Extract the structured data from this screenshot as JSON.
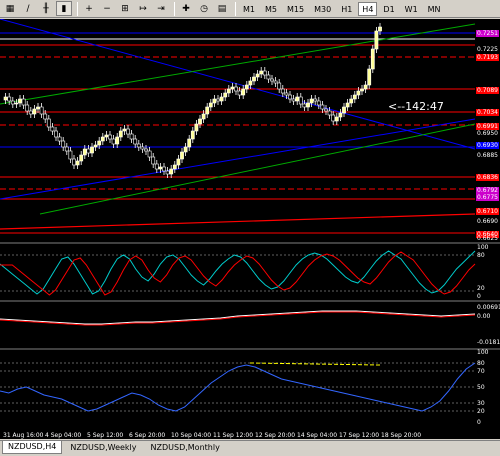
{
  "toolbar": {
    "icons": [
      {
        "name": "new-chart-icon",
        "glyph": "▦"
      },
      {
        "name": "line-chart-icon",
        "glyph": "∕"
      },
      {
        "name": "bar-chart-icon",
        "glyph": "╫"
      },
      {
        "name": "candlestick-icon",
        "glyph": "▮"
      },
      {
        "name": "zoom-in-icon",
        "glyph": "+"
      },
      {
        "name": "zoom-out-icon",
        "glyph": "−"
      },
      {
        "name": "tile-windows-icon",
        "glyph": "⊞"
      },
      {
        "name": "autoscroll-icon",
        "glyph": "↦"
      },
      {
        "name": "chart-shift-icon",
        "glyph": "⇥"
      },
      {
        "name": "indicators-icon",
        "glyph": "✚"
      },
      {
        "name": "periods-icon",
        "glyph": "◷"
      },
      {
        "name": "templates-icon",
        "glyph": "▤"
      }
    ],
    "timeframes": [
      "M1",
      "M5",
      "M15",
      "M30",
      "H1",
      "H4",
      "D1",
      "W1",
      "MN"
    ],
    "active_timeframe": "H4"
  },
  "chart": {
    "timer_label": "<--142:47",
    "price_labels": [
      {
        "text": "0.7251",
        "color": "#cc00cc"
      },
      {
        "text": "0.7225",
        "color": "#000000"
      },
      {
        "text": "0.7193",
        "color": "#ff0000"
      },
      {
        "text": "0.7089",
        "color": "#ff0000"
      },
      {
        "text": "0.7034",
        "color": "#ff0000"
      },
      {
        "text": "0.6991",
        "color": "#ff0000"
      },
      {
        "text": "0.6950",
        "color": "#000000"
      },
      {
        "text": "0.6930",
        "color": "#0000ff"
      },
      {
        "text": "0.6885",
        "color": "#000000"
      },
      {
        "text": "0.6836",
        "color": "#ff0000"
      },
      {
        "text": "0.6792",
        "color": "#cc00cc"
      },
      {
        "text": "0.6775",
        "color": "#cc00cc"
      },
      {
        "text": "0.6710",
        "color": "#ff0000"
      },
      {
        "text": "0.6690",
        "color": "#000000"
      },
      {
        "text": "0.6640",
        "color": "#ff0000"
      },
      {
        "text": "0.6625",
        "color": "#000000"
      }
    ],
    "stoch1_labels": [
      "100",
      "80",
      "20",
      "0"
    ],
    "macd_labels": [
      "0.00691",
      "0.00",
      "-0.01819"
    ],
    "stoch2_labels": [
      "100",
      "80",
      "70",
      "50",
      "30",
      "20",
      "0"
    ],
    "time_labels": [
      "31 Aug 16:00",
      "4 Sep 04:00",
      "5 Sep 12:00",
      "6 Sep 20:00",
      "10 Sep 04:00",
      "11 Sep 12:00",
      "12 Sep 20:00",
      "14 Sep 04:00",
      "17 Sep 12:00",
      "18 Sep 20:00"
    ]
  },
  "tabs": [
    {
      "label": "NZDUSD,H4",
      "active": true
    },
    {
      "label": "NZDUSD,Weekly",
      "active": false
    },
    {
      "label": "NZDUSD,Monthly",
      "active": false
    }
  ]
}
